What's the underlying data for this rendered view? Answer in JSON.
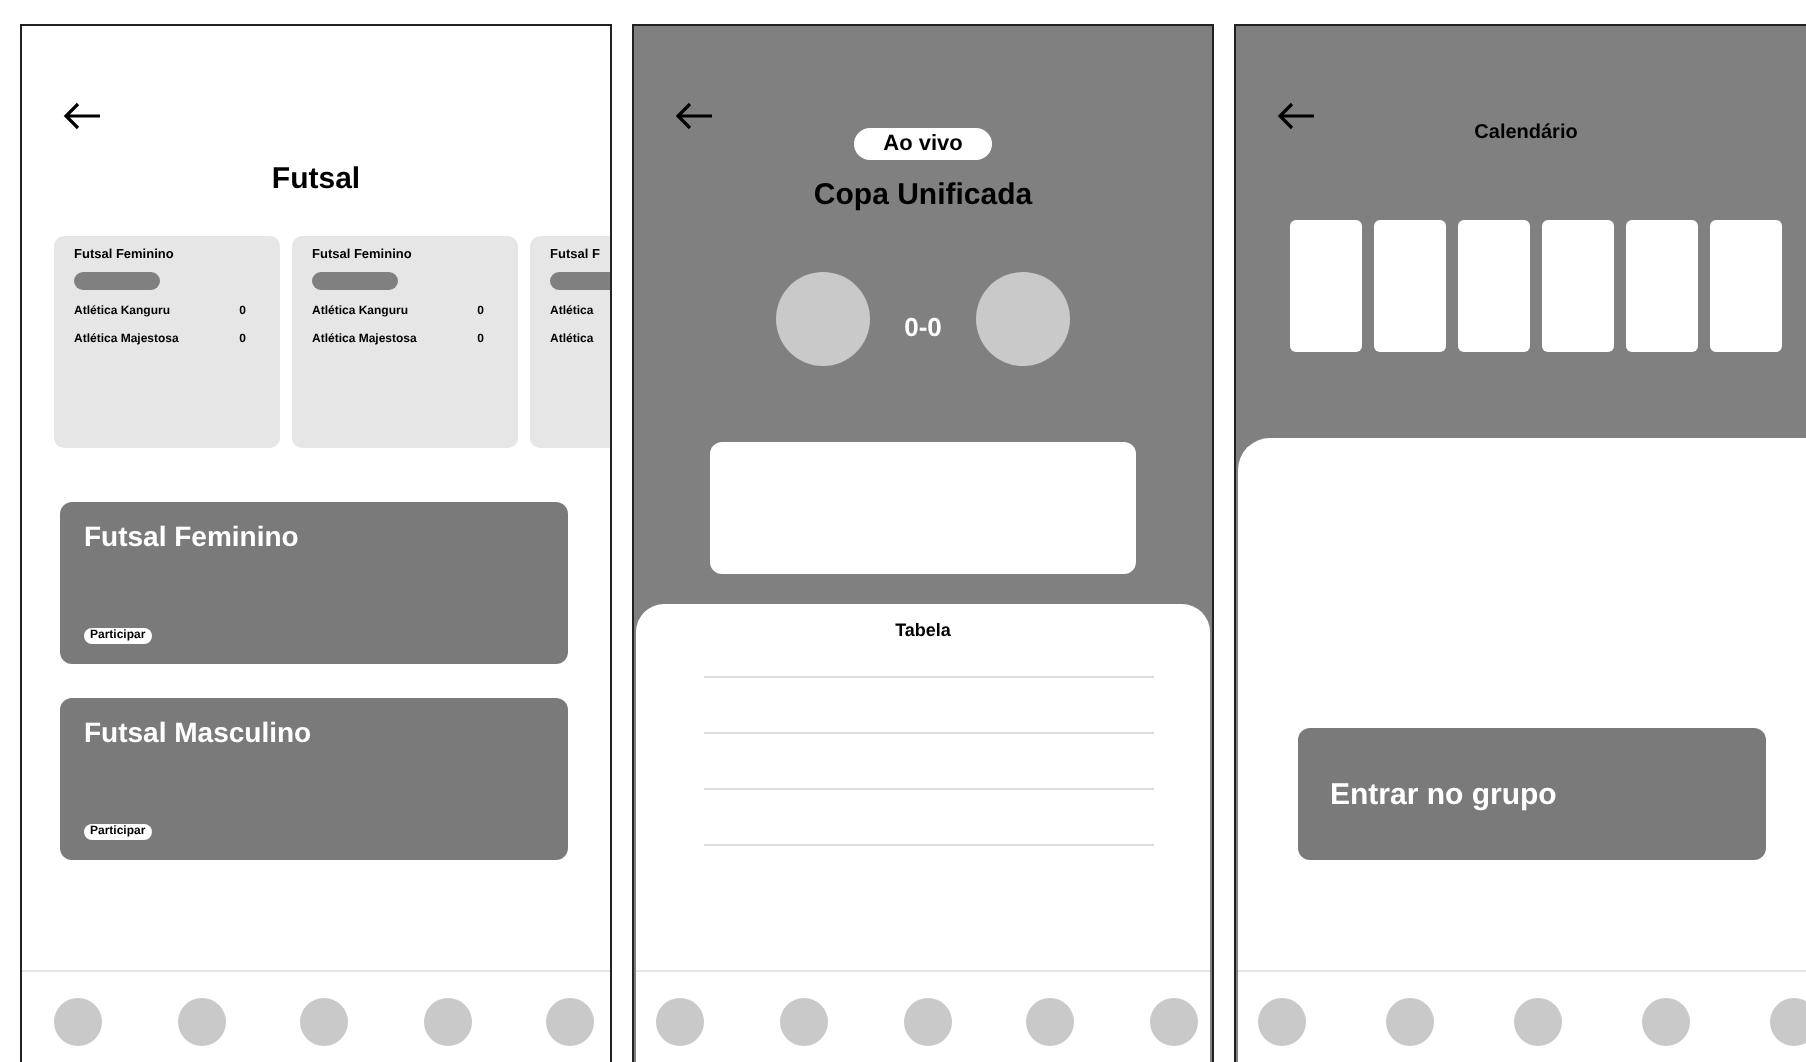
{
  "screens": [
    {
      "kind": "list",
      "title": "Futsal",
      "cards": [
        {
          "title": "Futsal Feminino",
          "teams": [
            {
              "name": "Atlética Kanguru",
              "score": "0"
            },
            {
              "name": "Atlética Majestosa",
              "score": "0"
            }
          ]
        },
        {
          "title": "Futsal Feminino",
          "teams": [
            {
              "name": "Atlética Kanguru",
              "score": "0"
            },
            {
              "name": "Atlética Majestosa",
              "score": "0"
            }
          ]
        },
        {
          "title": "Futsal F",
          "teams": [
            {
              "name": "Atlética"
            },
            {
              "name": "Atlética"
            }
          ]
        }
      ],
      "events": [
        {
          "title": "Futsal Feminino",
          "action": "Participar"
        },
        {
          "title": "Futsal Masculino",
          "action": "Participar"
        }
      ]
    },
    {
      "kind": "match",
      "badge": "Ao vivo",
      "title": "Copa Unificada",
      "score": "0-0",
      "table_title": "Tabela"
    },
    {
      "kind": "calendar",
      "title": "Calendário",
      "button": "Entrar no grupo"
    }
  ]
}
